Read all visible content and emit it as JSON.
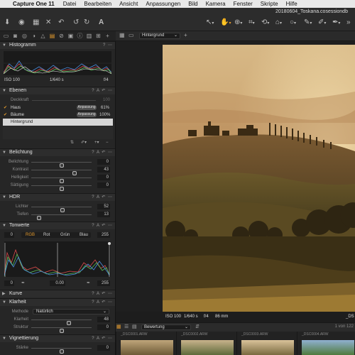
{
  "menubar": {
    "app_name": "Capture One 11",
    "items": [
      "Datei",
      "Bearbeiten",
      "Ansicht",
      "Anpassungen",
      "Bild",
      "Kamera",
      "Fenster",
      "Skripte",
      "Hilfe"
    ]
  },
  "window": {
    "document_title": "20180604_Toskana.cosessiondb"
  },
  "viewer_bar": {
    "background_select": "Hintergrund"
  },
  "histogram": {
    "title": "Histogramm",
    "iso": "ISO 100",
    "shutter": "1/640 s",
    "aperture": "f/4"
  },
  "layers": {
    "title": "Ebenen",
    "opacity_label": "Deckkraft",
    "opacity_value": "100",
    "items": [
      {
        "name": "Haus",
        "type": "Anpassung",
        "opacity": "61%"
      },
      {
        "name": "Bäume",
        "type": "Anpassung",
        "opacity": "100%"
      },
      {
        "name": "Hintergrund"
      }
    ]
  },
  "exposure": {
    "title": "Belichtung",
    "sliders": [
      {
        "label": "Belichtung",
        "value": "0",
        "level": 0.5
      },
      {
        "label": "Kontrast",
        "value": "43",
        "level": 0.72
      },
      {
        "label": "Helligkeit",
        "value": "0",
        "level": 0.5
      },
      {
        "label": "Sättigung",
        "value": "0",
        "level": 0.5
      }
    ]
  },
  "hdr": {
    "title": "HDR",
    "sliders": [
      {
        "label": "Lichter",
        "value": "52",
        "level": 0.52
      },
      {
        "label": "Tiefen",
        "value": "13",
        "level": 0.13
      }
    ]
  },
  "levels": {
    "title": "Tonwerte",
    "input_min": "0",
    "input_max": "255",
    "channels": [
      "RGB",
      "Rot",
      "Grün",
      "Blau"
    ],
    "output_min": "0",
    "midpoint": "0.00",
    "output_max": "255"
  },
  "curve": {
    "title": "Kurve"
  },
  "clarity": {
    "title": "Klarheit",
    "method_label": "Methode",
    "method_value": "Natürlich",
    "sliders": [
      {
        "label": "Klarheit",
        "value": "48",
        "level": 0.62
      },
      {
        "label": "Struktur",
        "value": "0",
        "level": 0.5
      }
    ]
  },
  "vignetting": {
    "title": "Vignettierung",
    "sliders": [
      {
        "label": "Stärke",
        "value": "0",
        "level": 0.5
      }
    ]
  },
  "image_info": {
    "iso": "ISO 100",
    "shutter": "1/640 s",
    "aperture": "f/4",
    "focal_length": "86 mm",
    "filename": "_DS"
  },
  "browser": {
    "sort_select": "Bewertung",
    "count": "1 von 122"
  },
  "filmstrip": {
    "names": [
      "_DSC0001.ARW",
      "_DSC0002.ARW",
      "_DSC0003.ARW",
      "_DSC0004.ARW"
    ]
  },
  "colors": {
    "accent": "#e39a2d",
    "panel": "#262626",
    "header": "#2d2d2d"
  }
}
